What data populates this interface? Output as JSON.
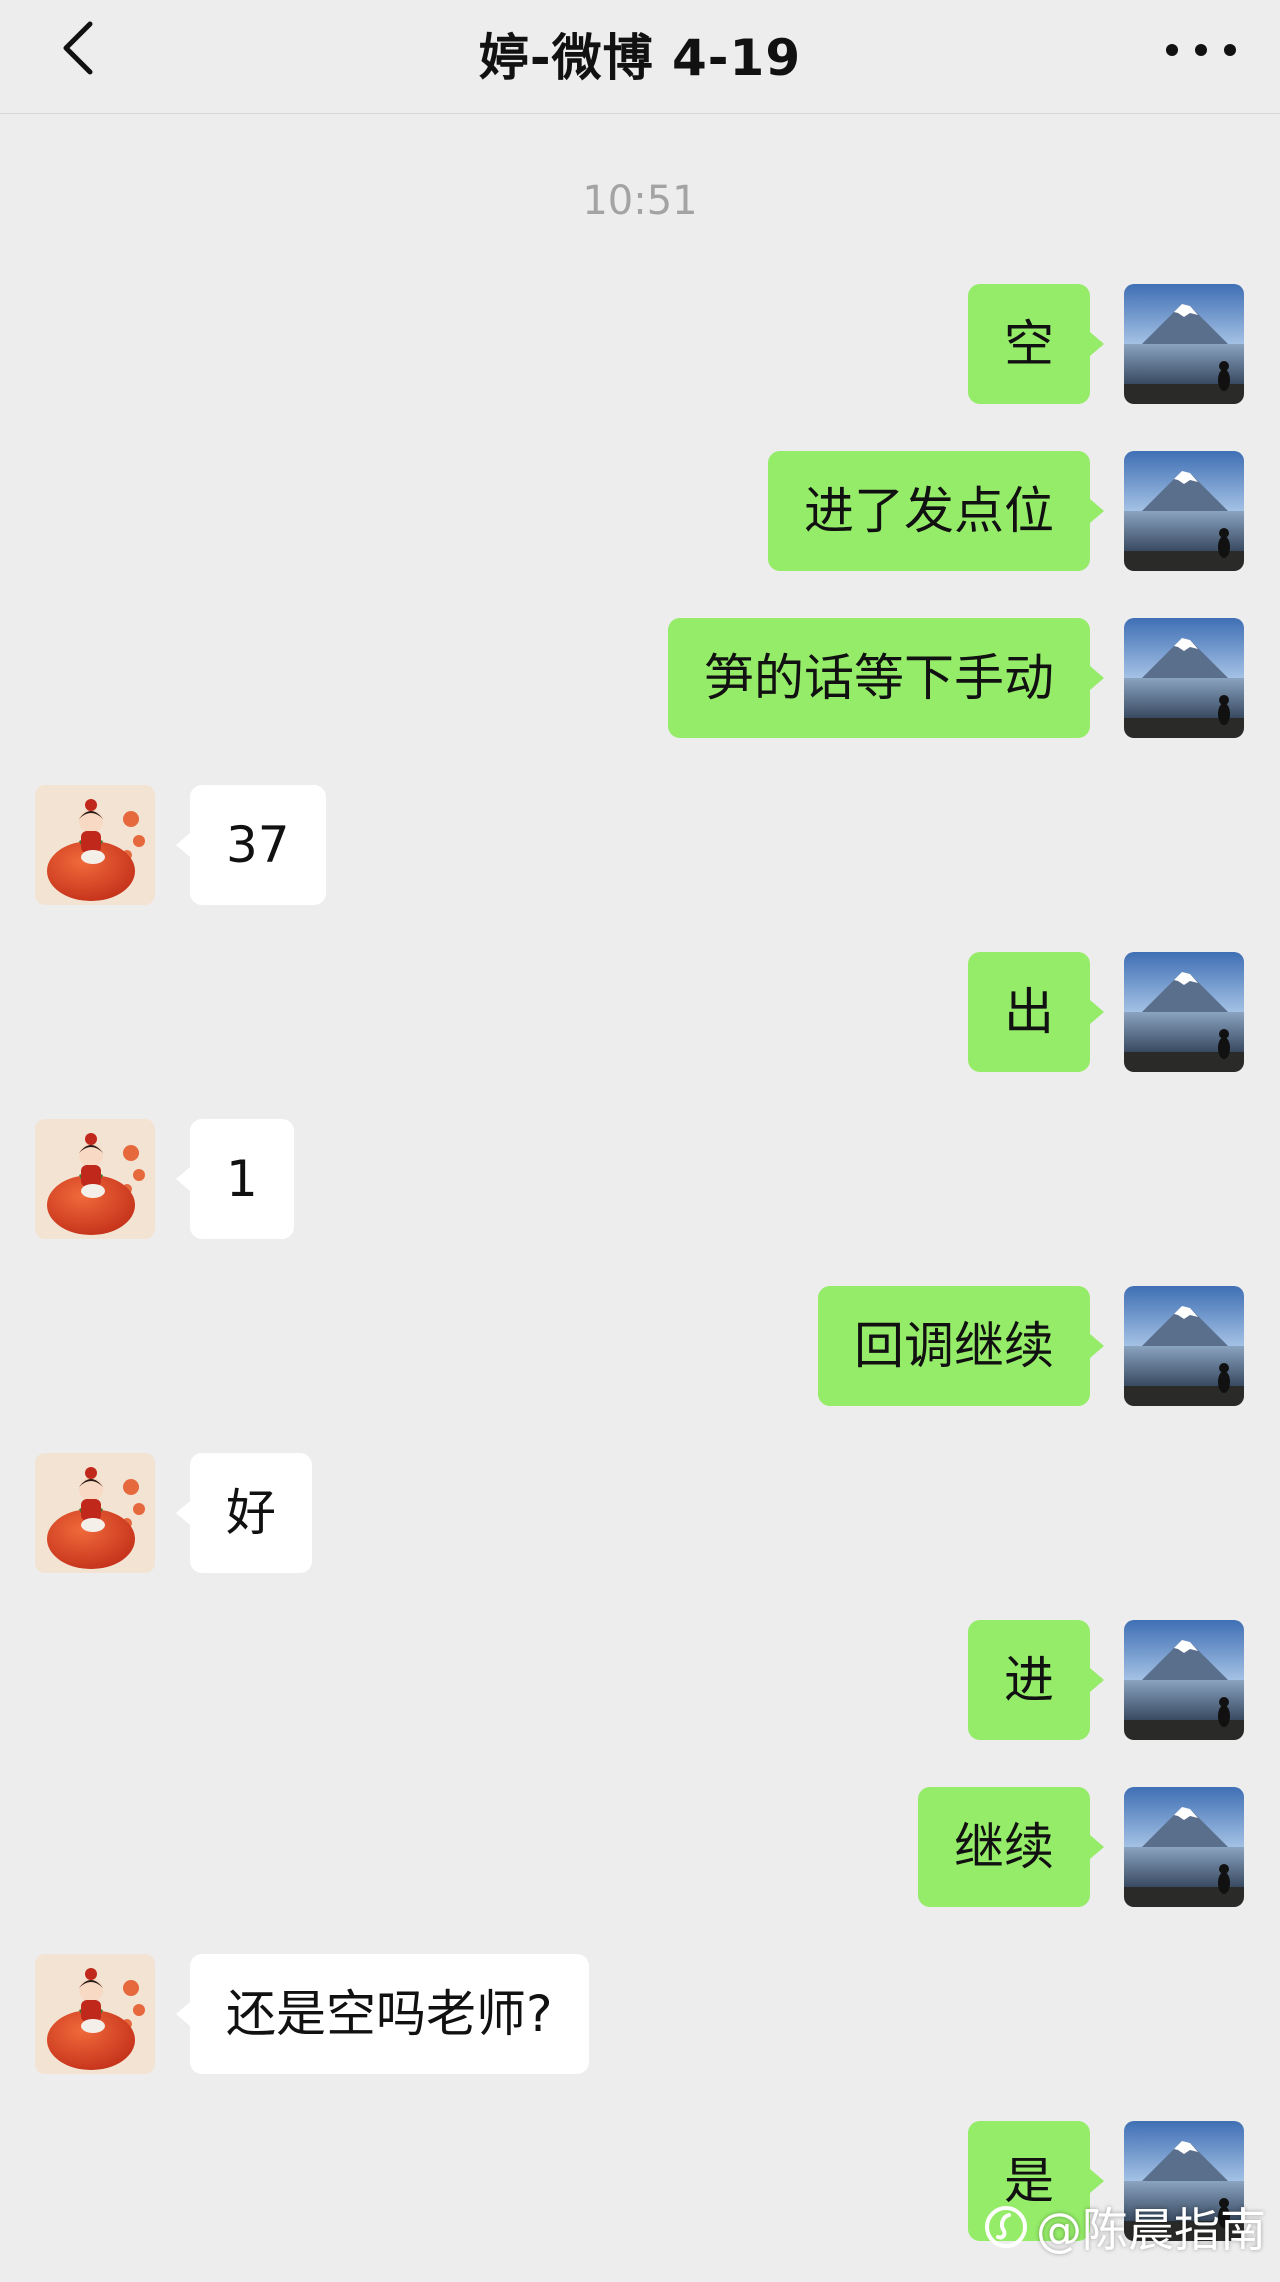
{
  "header": {
    "title": "婷-微博 4-19"
  },
  "chat": {
    "timestamp": "10:51",
    "messages": [
      {
        "sender": "me",
        "text": "空"
      },
      {
        "sender": "me",
        "text": "进了发点位"
      },
      {
        "sender": "me",
        "text": "笋的话等下手动"
      },
      {
        "sender": "them",
        "text": "37"
      },
      {
        "sender": "me",
        "text": "出"
      },
      {
        "sender": "them",
        "text": "1"
      },
      {
        "sender": "me",
        "text": "回调继续"
      },
      {
        "sender": "them",
        "text": "好"
      },
      {
        "sender": "me",
        "text": "进"
      },
      {
        "sender": "me",
        "text": "继续"
      },
      {
        "sender": "them",
        "text": "还是空吗老师?"
      },
      {
        "sender": "me",
        "text": "是"
      }
    ]
  },
  "watermark": {
    "text": "@陈晨指南"
  },
  "colors": {
    "background": "#ededed",
    "my_bubble": "#95ec69",
    "their_bubble": "#ffffff",
    "timestamp_text": "#a3a3a3"
  },
  "icons": {
    "back": "chevron-left-icon",
    "more": "more-dots-icon"
  }
}
